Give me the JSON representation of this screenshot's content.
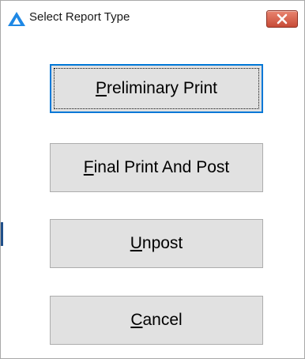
{
  "window": {
    "title": "Select Report Type",
    "icon": "app-triangle-icon",
    "close_icon": "close-icon",
    "close_color": "#c74b37"
  },
  "buttons": [
    {
      "id": "preliminary-print",
      "mnemonic": "P",
      "rest": "reliminary Print",
      "default": true
    },
    {
      "id": "final-print-and-post",
      "mnemonic": "F",
      "rest": "inal Print And Post",
      "default": false
    },
    {
      "id": "unpost",
      "mnemonic": "U",
      "rest": "npost",
      "default": false
    },
    {
      "id": "cancel",
      "mnemonic": "C",
      "rest": "ancel",
      "default": false
    }
  ],
  "colors": {
    "button_face": "#e1e1e1",
    "default_border": "#0078d7",
    "icon_blue": "#1e88e5"
  }
}
